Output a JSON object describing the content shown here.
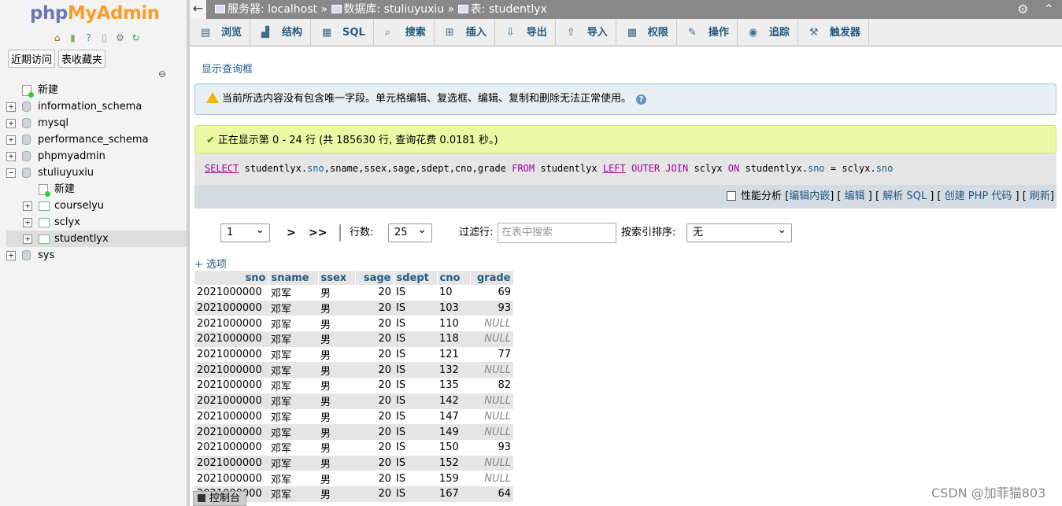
{
  "nav": {
    "logo_php": "php",
    "logo_myadmin": "MyAdmin",
    "icons": [
      "home-icon",
      "exit-icon",
      "help-icon",
      "docs-icon",
      "settings-icon",
      "reload-icon"
    ],
    "tab_recent": "近期访问",
    "tab_favorites": "表收藏夹",
    "tree": [
      {
        "label": "新建",
        "type": "new"
      },
      {
        "label": "information_schema",
        "type": "db"
      },
      {
        "label": "mysql",
        "type": "db"
      },
      {
        "label": "performance_schema",
        "type": "db"
      },
      {
        "label": "phpmyadmin",
        "type": "db"
      },
      {
        "label": "stuliuyuxiu",
        "type": "db",
        "expanded": true
      },
      {
        "label": "新建",
        "type": "new",
        "child": true
      },
      {
        "label": "courselyu",
        "type": "table",
        "child": true
      },
      {
        "label": "sclyx",
        "type": "table",
        "child": true
      },
      {
        "label": "studentlyx",
        "type": "table",
        "child": true,
        "selected": true
      },
      {
        "label": "sys",
        "type": "db"
      }
    ]
  },
  "breadcrumb": {
    "server": "服务器: localhost",
    "sep": "»",
    "database": "数据库: stuliuyuxiu",
    "table": "表: studentlyx"
  },
  "tabs": [
    {
      "label": "浏览",
      "icon": "browse-icon"
    },
    {
      "label": "结构",
      "icon": "structure-icon"
    },
    {
      "label": "SQL",
      "icon": "sql-icon"
    },
    {
      "label": "搜索",
      "icon": "search-icon"
    },
    {
      "label": "插入",
      "icon": "insert-icon"
    },
    {
      "label": "导出",
      "icon": "export-icon"
    },
    {
      "label": "导入",
      "icon": "import-icon"
    },
    {
      "label": "权限",
      "icon": "privileges-icon"
    },
    {
      "label": "操作",
      "icon": "operations-icon"
    },
    {
      "label": "追踪",
      "icon": "tracking-icon"
    },
    {
      "label": "触发器",
      "icon": "triggers-icon"
    }
  ],
  "main": {
    "show_query": "显示查询框",
    "warning": "当前所选内容没有包含唯一字段。单元格编辑、复选框、编辑、复制和删除无法正常使用。",
    "success": "正在显示第 0 - 24 行 (共 185630 行, 查询花费 0.0181 秒。)",
    "sql": {
      "select": "SELECT",
      "part1": "studentlyx.",
      "sno1": "sno",
      "part2": ",sname,ssex,sage,sdept,cno,grade",
      "from": "FROM",
      "part3": "studentlyx",
      "left": "LEFT",
      "outer_join": "OUTER JOIN",
      "part4": "sclyx",
      "on": "ON",
      "part5": "studentlyx.",
      "sno2": "sno",
      "part6": "= sclyx.",
      "sno3": "sno"
    },
    "tools": {
      "profiling": "性能分析",
      "edit_inline": "编辑内嵌",
      "edit": "编辑",
      "explain": "解析 SQL",
      "php_code": "创建 PHP 代码",
      "refresh": "刷新"
    },
    "controls": {
      "page": "1",
      "next": ">",
      "last": ">>",
      "rows_label": "行数:",
      "rows_value": "25",
      "filter_label": "过滤行:",
      "filter_placeholder": "在表中搜索",
      "sort_label": "按索引排序:",
      "sort_value": "无"
    },
    "options_link": "+ 选项",
    "table": {
      "columns": [
        "sno",
        "sname",
        "ssex",
        "sage",
        "sdept",
        "cno",
        "grade"
      ],
      "rows": [
        [
          "2021000000",
          "邓军",
          "男",
          "20",
          "IS",
          "10",
          "69"
        ],
        [
          "2021000000",
          "邓军",
          "男",
          "20",
          "IS",
          "103",
          "93"
        ],
        [
          "2021000000",
          "邓军",
          "男",
          "20",
          "IS",
          "110",
          "NULL"
        ],
        [
          "2021000000",
          "邓军",
          "男",
          "20",
          "IS",
          "118",
          "NULL"
        ],
        [
          "2021000000",
          "邓军",
          "男",
          "20",
          "IS",
          "121",
          "77"
        ],
        [
          "2021000000",
          "邓军",
          "男",
          "20",
          "IS",
          "132",
          "NULL"
        ],
        [
          "2021000000",
          "邓军",
          "男",
          "20",
          "IS",
          "135",
          "82"
        ],
        [
          "2021000000",
          "邓军",
          "男",
          "20",
          "IS",
          "142",
          "NULL"
        ],
        [
          "2021000000",
          "邓军",
          "男",
          "20",
          "IS",
          "147",
          "NULL"
        ],
        [
          "2021000000",
          "邓军",
          "男",
          "20",
          "IS",
          "149",
          "NULL"
        ],
        [
          "2021000000",
          "邓军",
          "男",
          "20",
          "IS",
          "150",
          "93"
        ],
        [
          "2021000000",
          "邓军",
          "男",
          "20",
          "IS",
          "152",
          "NULL"
        ],
        [
          "2021000000",
          "邓军",
          "男",
          "20",
          "IS",
          "159",
          "NULL"
        ],
        [
          "2021000000",
          "邓军",
          "男",
          "20",
          "IS",
          "167",
          "64"
        ]
      ]
    },
    "console": "控制台"
  },
  "watermark": "CSDN @加菲猫803"
}
